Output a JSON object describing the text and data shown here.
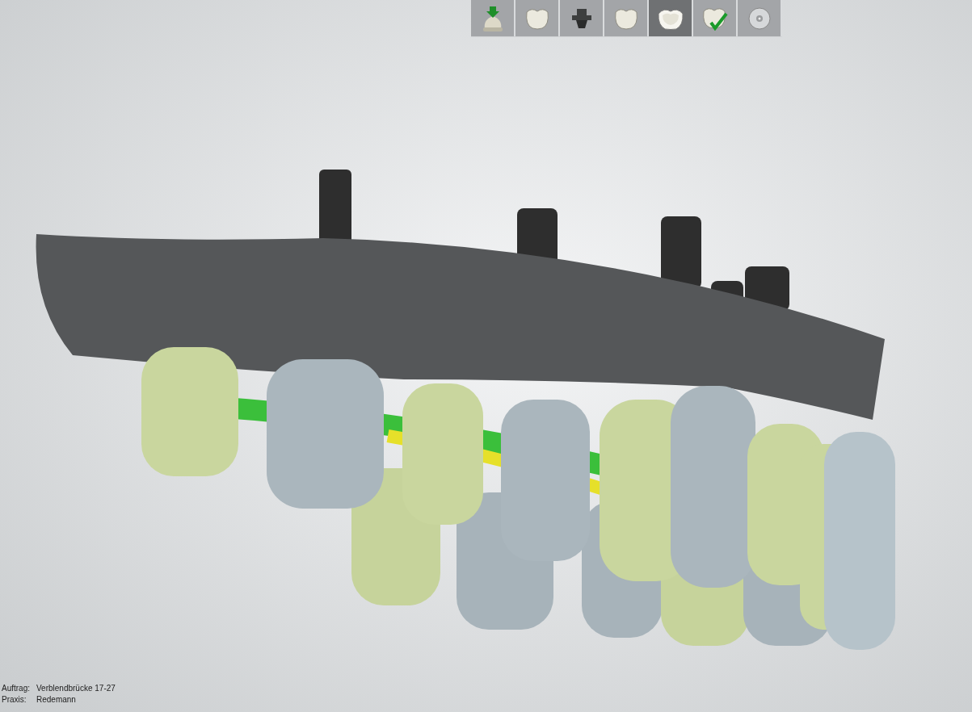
{
  "workflow_steps": [
    {
      "selected": false
    },
    {
      "selected": false
    },
    {
      "selected": false
    },
    {
      "selected": false
    },
    {
      "selected": true
    },
    {
      "selected": false
    },
    {
      "selected": false
    }
  ],
  "job_info": [
    {
      "label": "Auftrag:",
      "value": "Verblendbrücke 17-27"
    },
    {
      "label": "Praxis:",
      "value": "Redemann"
    }
  ]
}
